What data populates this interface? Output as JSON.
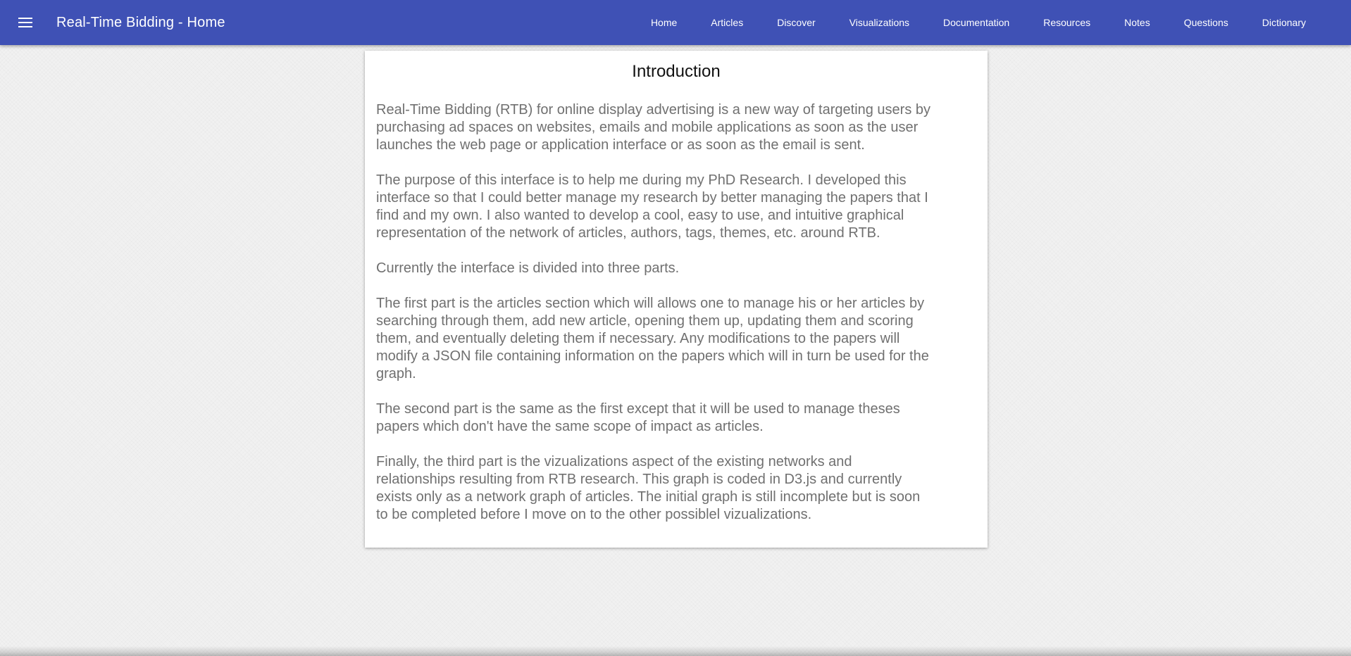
{
  "header": {
    "menu_icon": "hamburger-menu-icon",
    "title": "Real-Time Bidding - Home",
    "bg_color": "#3f51b5",
    "nav": [
      {
        "label": "Home"
      },
      {
        "label": "Articles"
      },
      {
        "label": "Discover"
      },
      {
        "label": "Visualizations"
      },
      {
        "label": "Documentation"
      },
      {
        "label": "Resources"
      },
      {
        "label": "Notes"
      },
      {
        "label": "Questions"
      },
      {
        "label": "Dictionary"
      }
    ]
  },
  "card": {
    "title": "Introduction",
    "paragraphs": [
      "Real-Time Bidding (RTB) for online display advertising is a new way of targeting users by purchasing ad spaces on websites, emails and mobile applications as soon as the user launches the web page or application interface or as soon as the email is sent.",
      "The purpose of this interface is to help me during my PhD Research. I developed this interface so that I could better manage my research by better managing the papers that I find and my own. I also wanted to develop a cool, easy to use, and intuitive graphical representation of the network of articles, authors, tags, themes, etc. around RTB.",
      "Currently the interface is divided into three parts.",
      "The first part is the articles section which will allows one to manage his or her articles by searching through them, add new article, opening them up, updating them and scoring them, and eventually deleting them if necessary. Any modifications to the papers will modify a JSON file containing information on the papers which will in turn be used for the graph.",
      "The second part is the same as the first except that it will be used to manage theses papers which don't have the same scope of impact as articles.",
      "Finally, the third part is the vizualizations aspect of the existing networks and relationships resulting from RTB research. This graph is coded in D3.js and currently exists only as a network graph of articles. The initial graph is still incomplete but is soon to be completed before I move on to the other possiblel vizualizations."
    ]
  }
}
